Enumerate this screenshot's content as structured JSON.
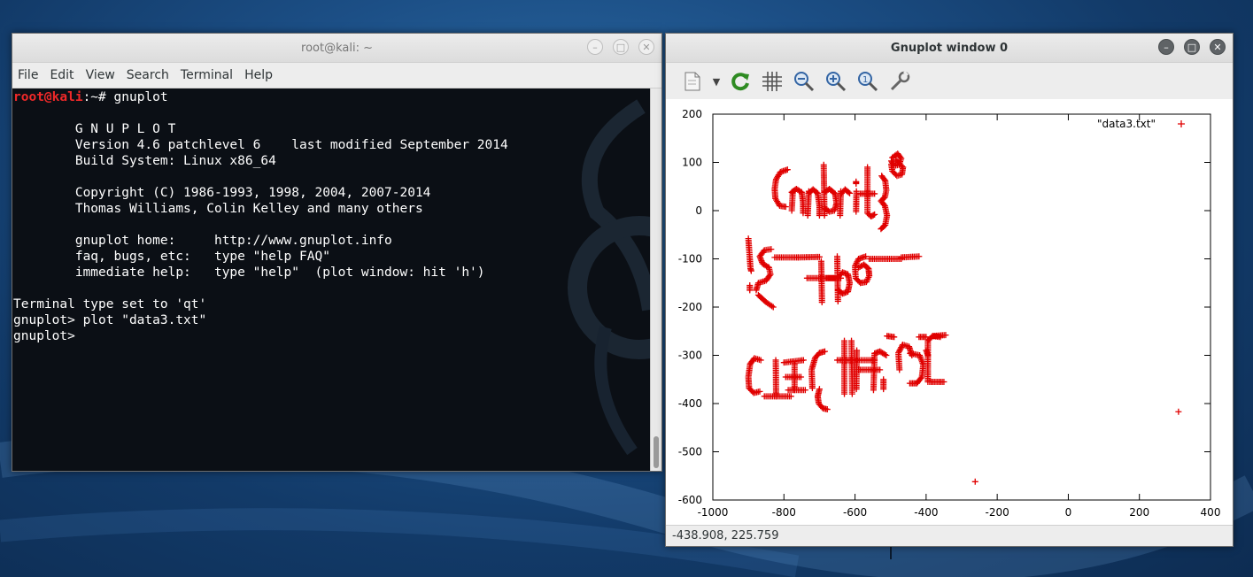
{
  "terminal": {
    "title": "root@kali: ~",
    "menu": [
      "File",
      "Edit",
      "View",
      "Search",
      "Terminal",
      "Help"
    ],
    "prompt_user": "root@kali",
    "prompt_path": ":~# ",
    "command": "gnuplot",
    "lines": [
      "",
      "\tG N U P L O T",
      "\tVersion 4.6 patchlevel 6    last modified September 2014",
      "\tBuild System: Linux x86_64",
      "",
      "\tCopyright (C) 1986-1993, 1998, 2004, 2007-2014",
      "\tThomas Williams, Colin Kelley and many others",
      "",
      "\tgnuplot home:     http://www.gnuplot.info",
      "\tfaq, bugs, etc:   type \"help FAQ\"",
      "\timmediate help:   type \"help\"  (plot window: hit 'h')",
      "",
      "Terminal type set to 'qt'",
      "gnuplot> plot \"data3.txt\"",
      "gnuplot> "
    ]
  },
  "gnuplot": {
    "title": "Gnuplot window 0",
    "toolbar": [
      {
        "name": "export-icon",
        "symbol": "document"
      },
      {
        "name": "replot-icon",
        "symbol": "refresh"
      },
      {
        "name": "grid-icon",
        "symbol": "grid"
      },
      {
        "name": "zoom-out-icon",
        "symbol": "zoom-out"
      },
      {
        "name": "zoom-in-icon",
        "symbol": "zoom-in"
      },
      {
        "name": "zoom-reset-icon",
        "symbol": "zoom-reset"
      },
      {
        "name": "settings-icon",
        "symbol": "wrench"
      }
    ],
    "status": "-438.908,  225.759",
    "accent": "#e00000"
  },
  "chart_data": {
    "type": "scatter",
    "title": "",
    "xlabel": "",
    "ylabel": "",
    "xlim": [
      -1000,
      400
    ],
    "ylim": [
      -600,
      200
    ],
    "xticks": [
      -1000,
      -800,
      -600,
      -400,
      -200,
      0,
      200,
      400
    ],
    "yticks": [
      200,
      100,
      0,
      -100,
      -200,
      -300,
      -400,
      -500,
      -600
    ],
    "grid": false,
    "legend": "top-right",
    "series": [
      {
        "name": "\"data3.txt\"",
        "color": "#e00000",
        "marker": "+",
        "isolated_points": [
          [
            310,
            -417
          ],
          [
            -262,
            -562
          ]
        ],
        "strokes": [
          [
            [
              -790,
              85
            ],
            [
              -810,
              80
            ],
            [
              -822,
              65
            ],
            [
              -826,
              45
            ],
            [
              -824,
              25
            ],
            [
              -812,
              10
            ],
            [
              -795,
              8
            ]
          ],
          [
            [
              -775,
              40
            ],
            [
              -778,
              0
            ]
          ],
          [
            [
              -778,
              38
            ],
            [
              -765,
              45
            ],
            [
              -750,
              38
            ],
            [
              -746,
              15
            ],
            [
              -746,
              -5
            ]
          ],
          [
            [
              -730,
              40
            ],
            [
              -733,
              -10
            ]
          ],
          [
            [
              -731,
              36
            ],
            [
              -718,
              44
            ],
            [
              -705,
              36
            ],
            [
              -700,
              10
            ],
            [
              -700,
              -10
            ]
          ],
          [
            [
              -688,
              95
            ],
            [
              -686,
              -10
            ]
          ],
          [
            [
              -686,
              38
            ],
            [
              -672,
              45
            ],
            [
              -656,
              35
            ],
            [
              -652,
              15
            ],
            [
              -658,
              0
            ],
            [
              -672,
              -2
            ],
            [
              -686,
              5
            ]
          ],
          [
            [
              -640,
              40
            ],
            [
              -642,
              -10
            ]
          ],
          [
            [
              -641,
              33
            ],
            [
              -628,
              44
            ],
            [
              -615,
              36
            ]
          ],
          [
            [
              -596,
              40
            ],
            [
              -597,
              -2
            ]
          ],
          [
            [
              -597,
              60
            ],
            [
              -597,
              56
            ]
          ],
          [
            [
              -585,
              35
            ],
            [
              -545,
              35
            ]
          ],
          [
            [
              -565,
              90
            ],
            [
              -565,
              -5
            ],
            [
              -555,
              -12
            ],
            [
              -545,
              -8
            ]
          ],
          [
            [
              -525,
              72
            ],
            [
              -515,
              62
            ],
            [
              -512,
              42
            ],
            [
              -516,
              28
            ],
            [
              -527,
              20
            ],
            [
              -516,
              10
            ],
            [
              -510,
              -10
            ],
            [
              -515,
              -30
            ],
            [
              -527,
              -38
            ]
          ],
          [
            [
              -495,
              110
            ],
            [
              -480,
              118
            ],
            [
              -470,
              108
            ],
            [
              -476,
              95
            ],
            [
              -490,
              93
            ],
            [
              -498,
              103
            ]
          ],
          [
            [
              -485,
              105
            ],
            [
              -465,
              90
            ],
            [
              -468,
              75
            ],
            [
              -482,
              72
            ],
            [
              -495,
              82
            ],
            [
              -498,
              96
            ]
          ],
          [
            [
              -900,
              -58
            ],
            [
              -894,
              -120
            ],
            [
              -892,
              -125
            ]
          ],
          [
            [
              -896,
              -155
            ],
            [
              -896,
              -165
            ]
          ],
          [
            [
              -836,
              -80
            ],
            [
              -855,
              -82
            ],
            [
              -868,
              -95
            ],
            [
              -860,
              -110
            ],
            [
              -842,
              -118
            ],
            [
              -838,
              -132
            ],
            [
              -850,
              -145
            ],
            [
              -872,
              -150
            ],
            [
              -878,
              -165
            ]
          ],
          [
            [
              -872,
              -175
            ],
            [
              -850,
              -190
            ],
            [
              -830,
              -200
            ]
          ],
          [
            [
              -826,
              -97
            ],
            [
              -760,
              -97
            ]
          ],
          [
            [
              -760,
              -97
            ],
            [
              -700,
              -96
            ]
          ],
          [
            [
              -735,
              -140
            ],
            [
              -655,
              -140
            ]
          ],
          [
            [
              -695,
              -105
            ],
            [
              -693,
              -190
            ]
          ],
          [
            [
              -680,
              -140
            ],
            [
              -640,
              -140
            ]
          ],
          [
            [
              -650,
              -95
            ],
            [
              -648,
              -188
            ]
          ],
          [
            [
              -648,
              -138
            ],
            [
              -635,
              -128
            ],
            [
              -620,
              -132
            ],
            [
              -615,
              -150
            ],
            [
              -620,
              -168
            ],
            [
              -635,
              -172
            ],
            [
              -648,
              -165
            ]
          ],
          [
            [
              -570,
              -95
            ],
            [
              -590,
              -100
            ],
            [
              -600,
              -115
            ],
            [
              -598,
              -140
            ],
            [
              -585,
              -150
            ],
            [
              -568,
              -148
            ],
            [
              -560,
              -135
            ],
            [
              -562,
              -120
            ],
            [
              -575,
              -112
            ],
            [
              -590,
              -118
            ]
          ],
          [
            [
              -560,
              -100
            ],
            [
              -470,
              -100
            ]
          ],
          [
            [
              -470,
              -97
            ],
            [
              -420,
              -95
            ]
          ],
          [
            [
              -865,
              -310
            ],
            [
              -883,
              -306
            ],
            [
              -895,
              -318
            ],
            [
              -900,
              -345
            ],
            [
              -898,
              -368
            ],
            [
              -885,
              -378
            ],
            [
              -868,
              -375
            ]
          ],
          [
            [
              -855,
              -385
            ],
            [
              -780,
              -385
            ]
          ],
          [
            [
              -823,
              -310
            ],
            [
              -822,
              -385
            ]
          ],
          [
            [
              -800,
              -315
            ],
            [
              -745,
              -310
            ]
          ],
          [
            [
              -795,
              -345
            ],
            [
              -752,
              -345
            ]
          ],
          [
            [
              -770,
              -318
            ],
            [
              -770,
              -372
            ]
          ],
          [
            [
              -788,
              -372
            ],
            [
              -740,
              -372
            ]
          ],
          [
            [
              -720,
              -368
            ],
            [
              -722,
              -330
            ],
            [
              -712,
              -305
            ],
            [
              -700,
              -295
            ],
            [
              -685,
              -292
            ]
          ],
          [
            [
              -700,
              -370
            ],
            [
              -705,
              -385
            ],
            [
              -702,
              -400
            ],
            [
              -690,
              -410
            ],
            [
              -678,
              -412
            ]
          ],
          [
            [
              -650,
              -310
            ],
            [
              -545,
              -310
            ]
          ],
          [
            [
              -630,
              -270
            ],
            [
              -630,
              -380
            ]
          ],
          [
            [
              -610,
              -270
            ],
            [
              -608,
              -380
            ]
          ],
          [
            [
              -595,
              -290
            ],
            [
              -596,
              -370
            ]
          ],
          [
            [
              -590,
              -330
            ],
            [
              -530,
              -330
            ]
          ],
          [
            [
              -548,
              -372
            ],
            [
              -545,
              -296
            ],
            [
              -530,
              -292
            ],
            [
              -512,
              -300
            ]
          ],
          [
            [
              -520,
              -350
            ],
            [
              -520,
              -370
            ]
          ],
          [
            [
              -510,
              -260
            ],
            [
              -490,
              -262
            ]
          ],
          [
            [
              -475,
              -330
            ],
            [
              -478,
              -295
            ],
            [
              -466,
              -278
            ],
            [
              -448,
              -282
            ],
            [
              -440,
              -300
            ]
          ],
          [
            [
              -445,
              -296
            ],
            [
              -418,
              -300
            ],
            [
              -408,
              -320
            ],
            [
              -412,
              -345
            ],
            [
              -426,
              -358
            ],
            [
              -446,
              -358
            ]
          ],
          [
            [
              -420,
              -262
            ],
            [
              -400,
              -262
            ]
          ],
          [
            [
              -395,
              -355
            ],
            [
              -395,
              -270
            ],
            [
              -382,
              -260
            ],
            [
              -360,
              -262
            ]
          ],
          [
            [
              -390,
              -355
            ],
            [
              -350,
              -355
            ]
          ],
          [
            [
              -395,
              -300
            ],
            [
              -400,
              -290
            ]
          ],
          [
            [
              -380,
              -260
            ],
            [
              -345,
              -258
            ]
          ]
        ]
      }
    ]
  }
}
